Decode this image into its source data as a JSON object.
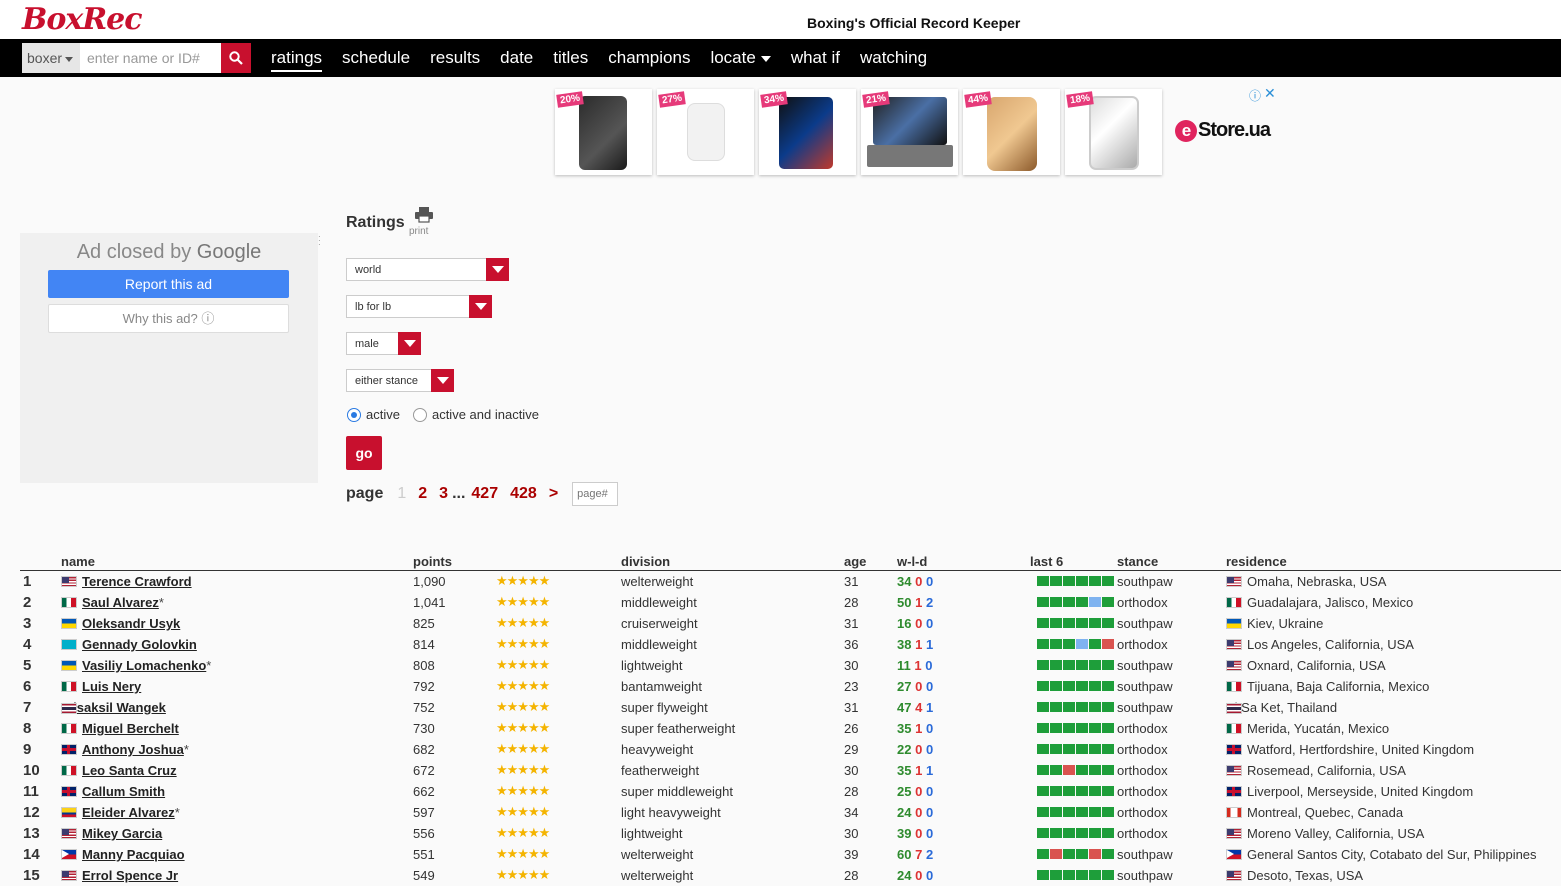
{
  "header": {
    "logo": "BoxRec",
    "tagline": "Boxing's Official Record Keeper"
  },
  "search": {
    "type": "boxer",
    "placeholder": "enter name or ID#"
  },
  "nav": [
    "ratings",
    "schedule",
    "results",
    "date",
    "titles",
    "champions",
    "locate",
    "what if",
    "watching"
  ],
  "top_ad": {
    "badges": [
      "20%",
      "27%",
      "34%",
      "21%",
      "44%",
      "18%"
    ],
    "brand": "Store.ua",
    "brand_initial": "e"
  },
  "side_ad": {
    "closed_text": "Ad closed by",
    "closed_brand": "Google",
    "report_label": "Report this ad",
    "why_label": "Why this ad? ⓘ"
  },
  "ratings": {
    "title": "Ratings",
    "print_label": "print",
    "filters": [
      "world",
      "lb for lb",
      "male",
      "either stance"
    ],
    "radio_active": "active",
    "radio_all": "active and inactive",
    "go_label": "go"
  },
  "pager": {
    "label": "page",
    "pages": [
      "1",
      "2",
      "3",
      "...",
      "427",
      "428",
      ">"
    ],
    "input_placeholder": "page#"
  },
  "table": {
    "headers": {
      "name": "name",
      "points": "points",
      "division": "division",
      "age": "age",
      "wld": "w-l-d",
      "last6": "last 6",
      "stance": "stance",
      "residence": "residence"
    },
    "rows": [
      {
        "rank": "1",
        "flag": "us",
        "name": "Terence Crawford",
        "suffix": "",
        "points": "1,090",
        "stars": "★★★★★",
        "division": "welterweight",
        "age": "31",
        "w": "34",
        "l": "0",
        "d": "0",
        "last6": [
          "W",
          "W",
          "W",
          "W",
          "W",
          "W"
        ],
        "stance": "southpaw",
        "res_flag": "us",
        "residence": "Omaha, Nebraska, USA"
      },
      {
        "rank": "2",
        "flag": "mx",
        "name": "Saul Alvarez",
        "suffix": "*",
        "points": "1,041",
        "stars": "★★★★★",
        "division": "middleweight",
        "age": "28",
        "w": "50",
        "l": "1",
        "d": "2",
        "last6": [
          "W",
          "W",
          "W",
          "W",
          "D",
          "W"
        ],
        "stance": "orthodox",
        "res_flag": "mx",
        "residence": "Guadalajara, Jalisco, Mexico"
      },
      {
        "rank": "3",
        "flag": "ua",
        "name": "Oleksandr Usyk",
        "suffix": "",
        "points": "825",
        "stars": "★★★★★",
        "division": "cruiserweight",
        "age": "31",
        "w": "16",
        "l": "0",
        "d": "0",
        "last6": [
          "W",
          "W",
          "W",
          "W",
          "W",
          "W"
        ],
        "stance": "southpaw",
        "res_flag": "ua",
        "residence": "Kiev, Ukraine"
      },
      {
        "rank": "4",
        "flag": "kz",
        "name": "Gennady Golovkin",
        "suffix": "",
        "points": "814",
        "stars": "★★★★★",
        "division": "middleweight",
        "age": "36",
        "w": "38",
        "l": "1",
        "d": "1",
        "last6": [
          "W",
          "W",
          "W",
          "D",
          "W",
          "L"
        ],
        "stance": "orthodox",
        "res_flag": "us",
        "residence": "Los Angeles, California, USA"
      },
      {
        "rank": "5",
        "flag": "ua",
        "name": "Vasiliy Lomachenko",
        "suffix": "*",
        "points": "808",
        "stars": "★★★★★",
        "division": "lightweight",
        "age": "30",
        "w": "11",
        "l": "1",
        "d": "0",
        "last6": [
          "W",
          "W",
          "W",
          "W",
          "W",
          "W"
        ],
        "stance": "southpaw",
        "res_flag": "us",
        "residence": "Oxnard, California, USA"
      },
      {
        "rank": "6",
        "flag": "mx",
        "name": "Luis Nery",
        "suffix": "",
        "points": "792",
        "stars": "★★★★★",
        "division": "bantamweight",
        "age": "23",
        "w": "27",
        "l": "0",
        "d": "0",
        "last6": [
          "W",
          "W",
          "W",
          "W",
          "W",
          "W"
        ],
        "stance": "southpaw",
        "res_flag": "mx",
        "residence": "Tijuana, Baja California, Mexico"
      },
      {
        "rank": "7",
        "flag": "th",
        "name": "Wisaksil Wangek",
        "suffix": "",
        "points": "752",
        "stars": "★★★★★",
        "division": "super flyweight",
        "age": "31",
        "w": "47",
        "l": "4",
        "d": "1",
        "last6": [
          "W",
          "W",
          "W",
          "W",
          "W",
          "W"
        ],
        "stance": "southpaw",
        "res_flag": "th",
        "residence": "Si Sa Ket, Thailand"
      },
      {
        "rank": "8",
        "flag": "mx",
        "name": "Miguel Berchelt",
        "suffix": "",
        "points": "730",
        "stars": "★★★★★",
        "division": "super featherweight",
        "age": "26",
        "w": "35",
        "l": "1",
        "d": "0",
        "last6": [
          "W",
          "W",
          "W",
          "W",
          "W",
          "W"
        ],
        "stance": "orthodox",
        "res_flag": "mx",
        "residence": "Merida, Yucatán, Mexico"
      },
      {
        "rank": "9",
        "flag": "gb",
        "name": "Anthony Joshua",
        "suffix": "*",
        "points": "682",
        "stars": "★★★★★",
        "division": "heavyweight",
        "age": "29",
        "w": "22",
        "l": "0",
        "d": "0",
        "last6": [
          "W",
          "W",
          "W",
          "W",
          "W",
          "W"
        ],
        "stance": "orthodox",
        "res_flag": "gb",
        "residence": "Watford, Hertfordshire, United Kingdom"
      },
      {
        "rank": "10",
        "flag": "mx",
        "name": "Leo Santa Cruz",
        "suffix": "",
        "points": "672",
        "stars": "★★★★★",
        "division": "featherweight",
        "age": "30",
        "w": "35",
        "l": "1",
        "d": "1",
        "last6": [
          "W",
          "W",
          "L",
          "W",
          "W",
          "W"
        ],
        "stance": "orthodox",
        "res_flag": "us",
        "residence": "Rosemead, California, USA"
      },
      {
        "rank": "11",
        "flag": "gb",
        "name": "Callum Smith",
        "suffix": "",
        "points": "662",
        "stars": "★★★★★",
        "division": "super middleweight",
        "age": "28",
        "w": "25",
        "l": "0",
        "d": "0",
        "last6": [
          "W",
          "W",
          "W",
          "W",
          "W",
          "W"
        ],
        "stance": "orthodox",
        "res_flag": "gb",
        "residence": "Liverpool, Merseyside, United Kingdom"
      },
      {
        "rank": "12",
        "flag": "co",
        "name": "Eleider Alvarez",
        "suffix": "*",
        "points": "597",
        "stars": "★★★★★",
        "division": "light heavyweight",
        "age": "34",
        "w": "24",
        "l": "0",
        "d": "0",
        "last6": [
          "W",
          "W",
          "W",
          "W",
          "W",
          "W"
        ],
        "stance": "orthodox",
        "res_flag": "ca",
        "residence": "Montreal, Quebec, Canada"
      },
      {
        "rank": "13",
        "flag": "us",
        "name": "Mikey Garcia",
        "suffix": "",
        "points": "556",
        "stars": "★★★★★",
        "division": "lightweight",
        "age": "30",
        "w": "39",
        "l": "0",
        "d": "0",
        "last6": [
          "W",
          "W",
          "W",
          "W",
          "W",
          "W"
        ],
        "stance": "orthodox",
        "res_flag": "us",
        "residence": "Moreno Valley, California, USA"
      },
      {
        "rank": "14",
        "flag": "ph",
        "name": "Manny Pacquiao",
        "suffix": "",
        "points": "551",
        "stars": "★★★★★",
        "division": "welterweight",
        "age": "39",
        "w": "60",
        "l": "7",
        "d": "2",
        "last6": [
          "W",
          "L",
          "W",
          "W",
          "L",
          "W"
        ],
        "stance": "southpaw",
        "res_flag": "ph",
        "residence": "General Santos City, Cotabato del Sur, Philippines"
      },
      {
        "rank": "15",
        "flag": "us",
        "name": "Errol Spence Jr",
        "suffix": "",
        "points": "549",
        "stars": "★★★★★",
        "division": "welterweight",
        "age": "28",
        "w": "24",
        "l": "0",
        "d": "0",
        "last6": [
          "W",
          "W",
          "W",
          "W",
          "W",
          "W"
        ],
        "stance": "southpaw",
        "res_flag": "us",
        "residence": "Desoto, Texas, USA"
      }
    ]
  }
}
